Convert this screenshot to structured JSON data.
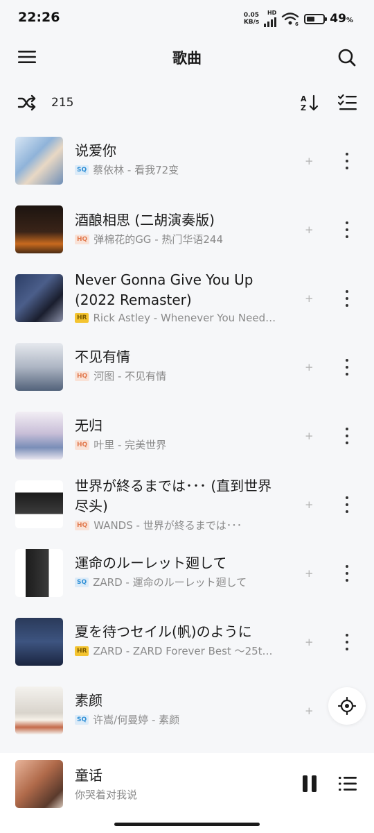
{
  "status_bar": {
    "time": "22:26",
    "net_speed_value": "0.05",
    "net_speed_unit": "KB/s",
    "net_type": "HD",
    "battery_percent": "49",
    "battery_percent_sign": "%",
    "battery_level": 0.49
  },
  "header": {
    "title": "歌曲",
    "menu_icon": "hamburger-menu-icon",
    "search_icon": "search-icon"
  },
  "toolbar": {
    "shuffle_icon": "shuffle-icon",
    "song_count": "215",
    "sort_icon": "sort-az-icon",
    "multiselect_icon": "checklist-icon"
  },
  "songs": [
    {
      "title": "说爱你",
      "quality": "SQ",
      "subtitle": "蔡依林 - 看我72变"
    },
    {
      "title": "酒酿相思 (二胡演奏版)",
      "quality": "HQ",
      "subtitle": "弹棉花的GG - 热门华语244"
    },
    {
      "title": "Never Gonna Give You Up (2022 Remaster)",
      "quality": "HR",
      "subtitle": "Rick Astley - Whenever You Need…"
    },
    {
      "title": "不见有情",
      "quality": "HQ",
      "subtitle": "河图 - 不见有情"
    },
    {
      "title": "无归",
      "quality": "HQ",
      "subtitle": "叶里 - 完美世界"
    },
    {
      "title": "世界が終るまでは･･･ (直到世界尽头)",
      "quality": "HQ",
      "subtitle": "WANDS - 世界が終るまでは･･･"
    },
    {
      "title": "運命のルーレット廻して",
      "quality": "SQ",
      "subtitle": "ZARD - 運命のルーレット廻して"
    },
    {
      "title": "夏を待つセイル(帆)のように",
      "quality": "HR",
      "subtitle": "ZARD - ZARD Forever Best ～25t…"
    },
    {
      "title": "素颜",
      "quality": "SQ",
      "subtitle": "许嵩/何曼婷 - 素颜"
    }
  ],
  "row_plus": "+",
  "now_playing": {
    "title": "童话",
    "subtitle": "你哭着对我说",
    "pause_icon": "pause-icon",
    "queue_icon": "playlist-icon"
  },
  "locate_icon": "locate-crosshair-icon",
  "colors": {
    "background": "#f6f7f9",
    "sq_badge": "#2e8fd6",
    "hq_badge": "#e27a4f",
    "hr_badge": "#f4c430"
  }
}
